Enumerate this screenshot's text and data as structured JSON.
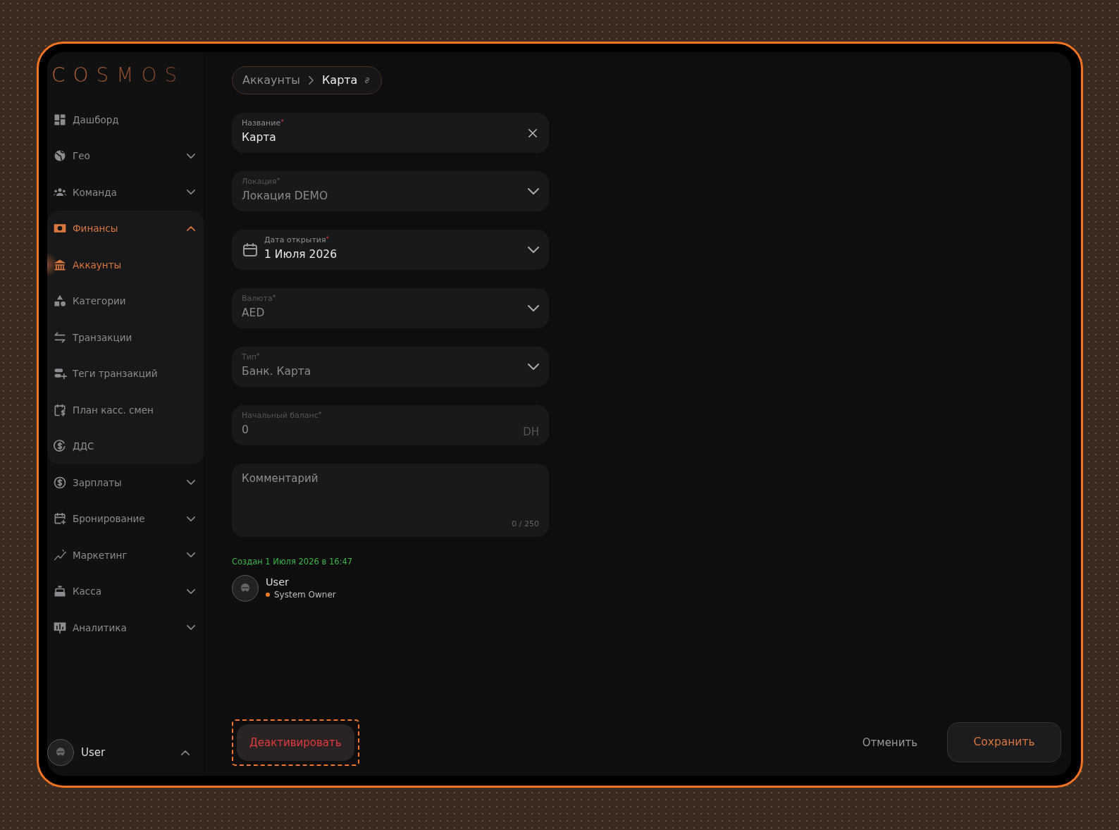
{
  "logo": "COSMOS",
  "sidebar": {
    "items": [
      {
        "label": "Дашборд",
        "kind": "link",
        "selected": false
      },
      {
        "label": "Гео",
        "kind": "group",
        "selected": false,
        "expanded": false
      },
      {
        "label": "Команда",
        "kind": "group",
        "selected": false,
        "expanded": false
      },
      {
        "label": "Финансы",
        "kind": "group",
        "selected": true,
        "expanded": true,
        "children": [
          {
            "label": "Аккаунты",
            "selected": true
          },
          {
            "label": "Категории",
            "selected": false
          },
          {
            "label": "Транзакции",
            "selected": false
          },
          {
            "label": "Теги транзакций",
            "selected": false
          },
          {
            "label": "План касс. смен",
            "selected": false
          },
          {
            "label": "ДДС",
            "selected": false
          }
        ]
      },
      {
        "label": "Зарплаты",
        "kind": "group",
        "selected": false,
        "expanded": false
      },
      {
        "label": "Бронирование",
        "kind": "group",
        "selected": false,
        "expanded": false
      },
      {
        "label": "Маркетинг",
        "kind": "group",
        "selected": false,
        "expanded": false
      },
      {
        "label": "Касса",
        "kind": "group",
        "selected": false,
        "expanded": false
      },
      {
        "label": "Аналитика",
        "kind": "group",
        "selected": false,
        "expanded": false
      }
    ],
    "user": {
      "name": "User"
    }
  },
  "breadcrumb": [
    "Аккаунты",
    "Карта"
  ],
  "form": {
    "fields": [
      {
        "kind": "text",
        "label": "Название$^{*}$",
        "value": "Карта",
        "disabled": false
      },
      {
        "kind": "select",
        "label": "Локация$^{*}$",
        "value": "Локация DEMO",
        "disabled": true
      },
      {
        "kind": "date",
        "label": "Дата открытия$^{*}$",
        "value": "1 Июля 2026",
        "disabled": false
      },
      {
        "kind": "select",
        "label": "Валюта$^{*}$",
        "value": "AED",
        "disabled": true
      },
      {
        "kind": "select",
        "label": "Тип$^{*}$",
        "value": "Банк. Карта",
        "disabled": true
      },
      {
        "kind": "number",
        "label": "Начальный баланс$^{*}$",
        "value": "0",
        "suffix": "DH",
        "disabled": true
      },
      {
        "kind": "textarea",
        "placeholder": "Комментарий",
        "counter": "0 / 250",
        "disabled": false
      }
    ]
  },
  "created": {
    "text": "Создан 1 Июля 2026 в 16:47",
    "author": "User",
    "role": "System Owner"
  },
  "actions": {
    "deactivate": "Деактивировать",
    "cancel": "Отменить",
    "save": "Сохранить"
  }
}
